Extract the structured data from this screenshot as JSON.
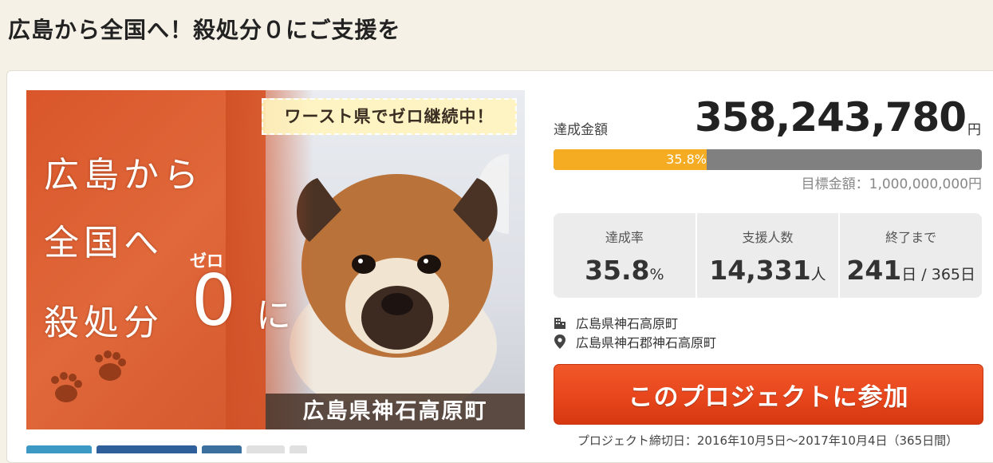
{
  "page": {
    "title": "広島から全国へ！殺処分０にご支援を"
  },
  "hero": {
    "banner": "ワースト県でゼロ継続中！",
    "line1": "広島から",
    "line2": "全国へ",
    "line3": "殺処分",
    "zero": "0",
    "zero_ruby": "ゼロ",
    "ni": "に",
    "caption": "広島県神石高原町"
  },
  "funding": {
    "amount_label": "達成金額",
    "amount": "358,243,780",
    "amount_unit": "円",
    "progress_percent": 35.8,
    "progress_text": "35.8%",
    "goal": "目標金額：1,000,000,000円"
  },
  "stats": {
    "rate": {
      "label": "達成率",
      "value": "35.8",
      "unit": "%"
    },
    "supporters": {
      "label": "支援人数",
      "value": "14,331",
      "unit": "人"
    },
    "remaining": {
      "label": "終了まで",
      "value": "241",
      "unit": "日 / 365日"
    }
  },
  "location": {
    "organization": "広島県神石高原町",
    "address": "広島県神石郡神石高原町"
  },
  "cta": {
    "label": "このプロジェクトに参加"
  },
  "deadline": "プロジェクト締切日：2016年10月5日〜2017年10月4日（365日間）",
  "colors": {
    "accent": "#f5ac22",
    "cta": "#e8461c",
    "track": "#808080"
  }
}
